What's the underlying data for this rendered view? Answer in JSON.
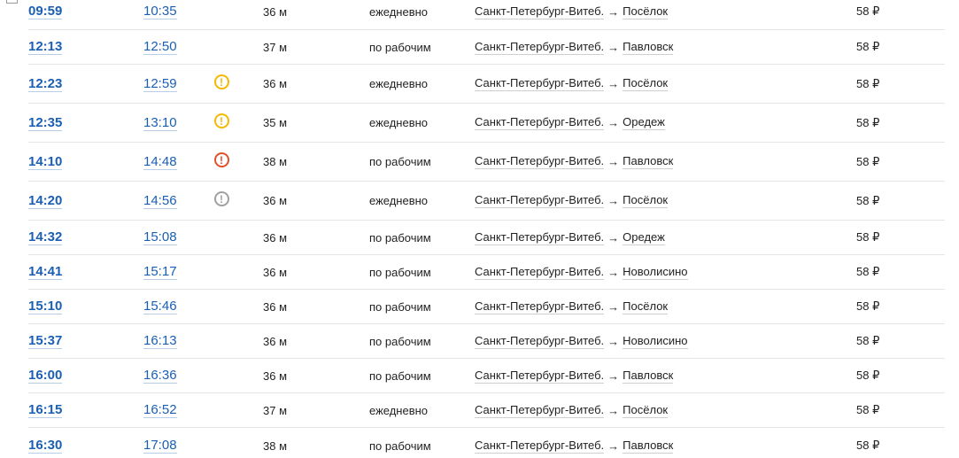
{
  "rows": [
    {
      "dep": "09:59",
      "arr": "10:35",
      "warning": "",
      "duration": "36 м",
      "days": "ежедневно",
      "from": "Санкт-Петербург-Витеб.",
      "arrow": "→",
      "to": "Посёлок",
      "price": "58 ₽"
    },
    {
      "dep": "12:13",
      "arr": "12:50",
      "warning": "",
      "duration": "37 м",
      "days": "по рабочим",
      "from": "Санкт-Петербург-Витеб.",
      "arrow": "→",
      "to": "Павловск",
      "price": "58 ₽"
    },
    {
      "dep": "12:23",
      "arr": "12:59",
      "warning": "yellow",
      "warning_glyph": "!",
      "duration": "36 м",
      "days": "ежедневно",
      "from": "Санкт-Петербург-Витеб.",
      "arrow": "→",
      "to": "Посёлок",
      "price": "58 ₽"
    },
    {
      "dep": "12:35",
      "arr": "13:10",
      "warning": "yellow",
      "warning_glyph": "!",
      "duration": "35 м",
      "days": "ежедневно",
      "from": "Санкт-Петербург-Витеб.",
      "arrow": "→",
      "to": "Оредеж",
      "price": "58 ₽"
    },
    {
      "dep": "14:10",
      "arr": "14:48",
      "warning": "red",
      "warning_glyph": "!",
      "duration": "38 м",
      "days": "по рабочим",
      "from": "Санкт-Петербург-Витеб.",
      "arrow": "→",
      "to": "Павловск",
      "price": "58 ₽"
    },
    {
      "dep": "14:20",
      "arr": "14:56",
      "warning": "grey",
      "warning_glyph": "!",
      "duration": "36 м",
      "days": "ежедневно",
      "from": "Санкт-Петербург-Витеб.",
      "arrow": "→",
      "to": "Посёлок",
      "price": "58 ₽"
    },
    {
      "dep": "14:32",
      "arr": "15:08",
      "warning": "",
      "duration": "36 м",
      "days": "по рабочим",
      "from": "Санкт-Петербург-Витеб.",
      "arrow": "→",
      "to": "Оредеж",
      "price": "58 ₽"
    },
    {
      "dep": "14:41",
      "arr": "15:17",
      "warning": "",
      "duration": "36 м",
      "days": "по рабочим",
      "from": "Санкт-Петербург-Витеб.",
      "arrow": "→",
      "to": "Новолисино",
      "price": "58 ₽"
    },
    {
      "dep": "15:10",
      "arr": "15:46",
      "warning": "",
      "duration": "36 м",
      "days": "по рабочим",
      "from": "Санкт-Петербург-Витеб.",
      "arrow": "→",
      "to": "Посёлок",
      "price": "58 ₽"
    },
    {
      "dep": "15:37",
      "arr": "16:13",
      "warning": "",
      "duration": "36 м",
      "days": "по рабочим",
      "from": "Санкт-Петербург-Витеб.",
      "arrow": "→",
      "to": "Новолисино",
      "price": "58 ₽"
    },
    {
      "dep": "16:00",
      "arr": "16:36",
      "warning": "",
      "duration": "36 м",
      "days": "по рабочим",
      "from": "Санкт-Петербург-Витеб.",
      "arrow": "→",
      "to": "Павловск",
      "price": "58 ₽"
    },
    {
      "dep": "16:15",
      "arr": "16:52",
      "warning": "",
      "duration": "37 м",
      "days": "ежедневно",
      "from": "Санкт-Петербург-Витеб.",
      "arrow": "→",
      "to": "Посёлок",
      "price": "58 ₽"
    },
    {
      "dep": "16:30",
      "arr": "17:08",
      "warning": "",
      "duration": "38 м",
      "days": "по рабочим",
      "from": "Санкт-Петербург-Витеб.",
      "arrow": "→",
      "to": "Павловск",
      "price": "58 ₽"
    }
  ],
  "colors": {
    "link": "#1a5fb4",
    "warning_yellow": "#f5b800",
    "warning_red": "#e0502c",
    "warning_grey": "#a0a0a0",
    "divider": "#e5e5e5"
  }
}
